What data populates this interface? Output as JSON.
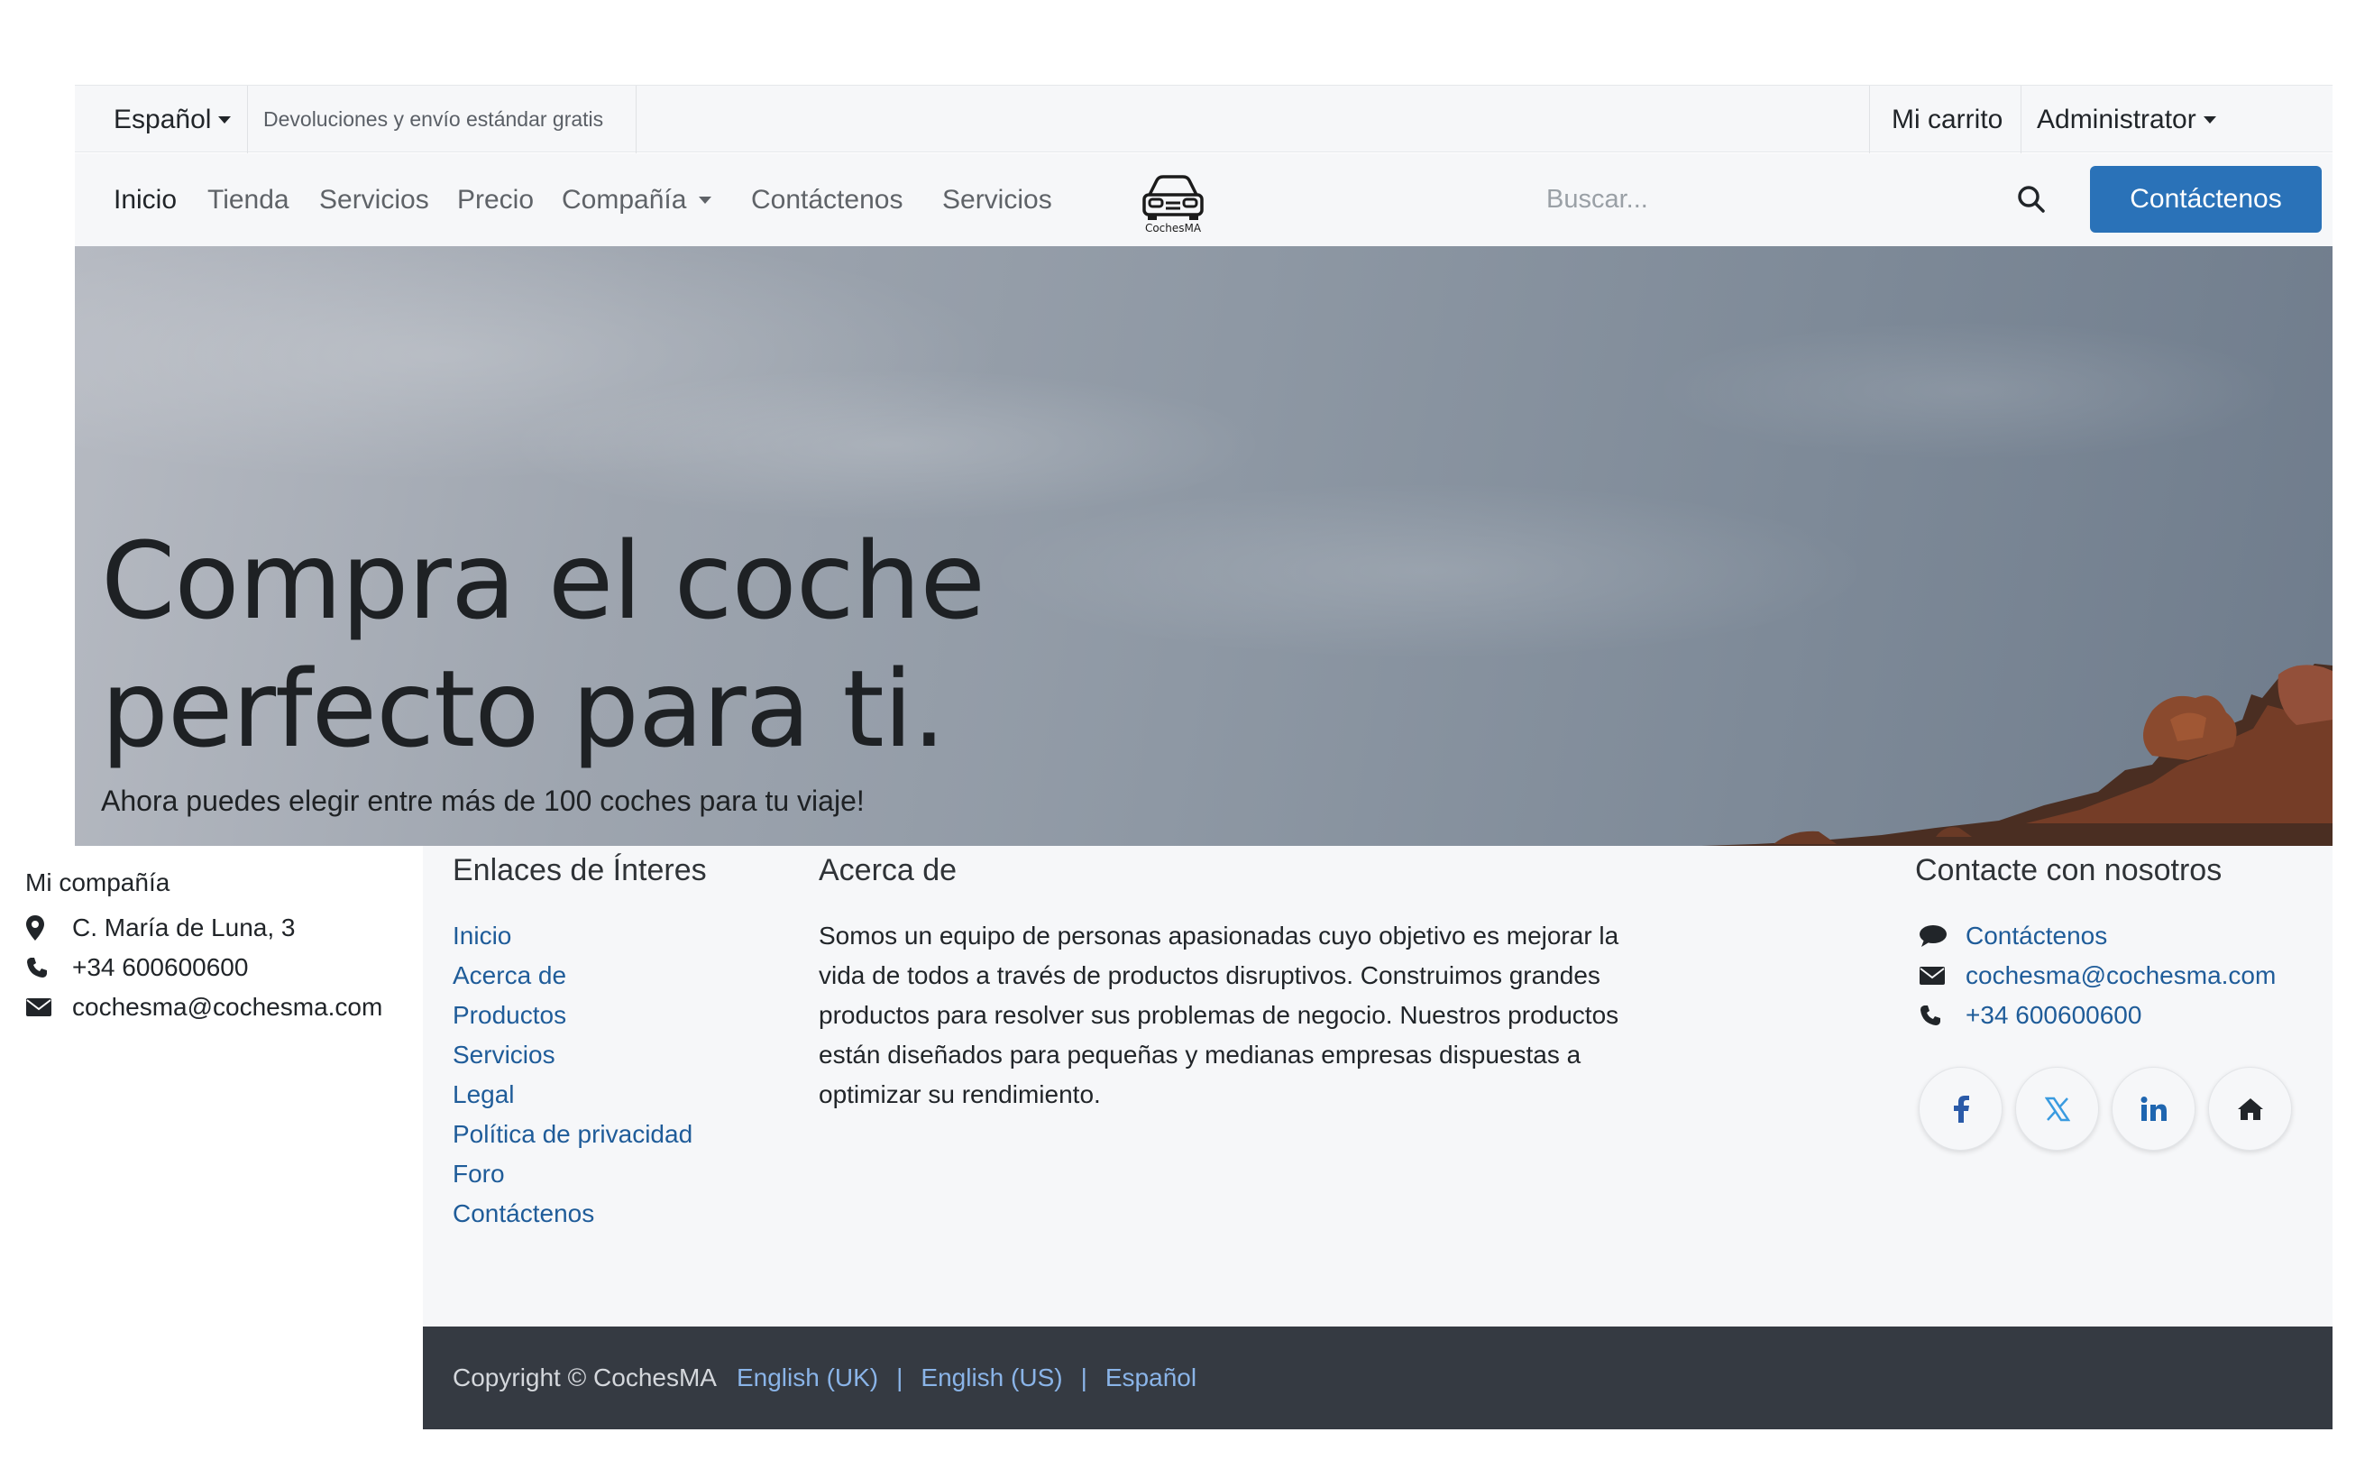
{
  "topbar": {
    "language": "Español",
    "promo": "Devoluciones y envío estándar gratis",
    "cart": "Mi carrito",
    "user": "Administrator"
  },
  "nav": {
    "items": [
      "Inicio",
      "Tienda",
      "Servicios",
      "Precio",
      "Compañía",
      "Contáctenos",
      "Servicios"
    ],
    "logo_text": "CochesMA",
    "search_placeholder": "Buscar...",
    "cta": "Contáctenos"
  },
  "hero": {
    "title_line1": "Compra el coche",
    "title_line2": "perfecto para ti.",
    "subtitle": "Ahora puedes elegir entre más de 100 coches para tu viaje!"
  },
  "address": {
    "company": "Mi compañía",
    "street": "C. María de Luna, 3",
    "phone": "+34 600600600",
    "email": "cochesma@cochesma.com"
  },
  "footer": {
    "links_title": "Enlaces de Ínteres",
    "links": [
      "Inicio",
      "Acerca de",
      "Productos",
      "Servicios",
      "Legal",
      "Política de privacidad",
      "Foro",
      "Contáctenos"
    ],
    "about_title": "Acerca de",
    "about_text": "Somos un equipo de personas apasionadas cuyo objetivo es mejorar la vida de todos a través de productos disruptivos. Construimos grandes productos para resolver sus problemas de negocio. Nuestros productos están diseñados para pequeñas y medianas empresas dispuestas a optimizar su rendimiento.",
    "contact_title": "Contacte con nosotros",
    "contact_link": "Contáctenos",
    "contact_email": "cochesma@cochesma.com",
    "contact_phone": "+34 600600600",
    "social": [
      "facebook-icon",
      "x-icon",
      "linkedin-icon",
      "home-icon"
    ]
  },
  "copyright": {
    "text": "Copyright © CochesMA",
    "languages": [
      "English (UK)",
      "English (US)",
      "Español"
    ],
    "separator": "|"
  },
  "colors": {
    "primary": "#2a72b8",
    "link": "#1f5c99",
    "footer_bg": "#f6f7f9",
    "copyright_bg": "#353a42"
  }
}
